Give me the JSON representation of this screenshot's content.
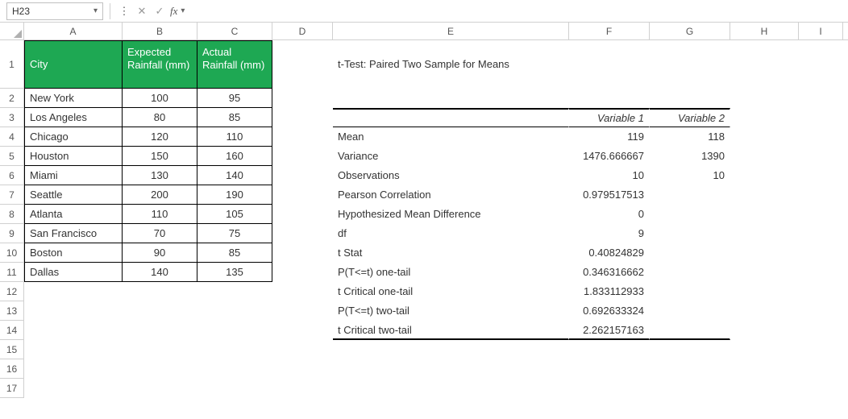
{
  "formula_bar": {
    "name_box": "H23",
    "formula_value": ""
  },
  "columns": [
    "A",
    "B",
    "C",
    "D",
    "E",
    "F",
    "G",
    "H",
    "I"
  ],
  "row_numbers": [
    1,
    2,
    3,
    4,
    5,
    6,
    7,
    8,
    9,
    10,
    11,
    12,
    13,
    14,
    15,
    16,
    17
  ],
  "data_table": {
    "headers": {
      "city": "City",
      "expected": "Expected Rainfall (mm)",
      "actual": "Actual Rainfall (mm)"
    },
    "rows": [
      {
        "city": "New York",
        "expected": 100,
        "actual": 95
      },
      {
        "city": "Los Angeles",
        "expected": 80,
        "actual": 85
      },
      {
        "city": "Chicago",
        "expected": 120,
        "actual": 110
      },
      {
        "city": "Houston",
        "expected": 150,
        "actual": 160
      },
      {
        "city": "Miami",
        "expected": 130,
        "actual": 140
      },
      {
        "city": "Seattle",
        "expected": 200,
        "actual": 190
      },
      {
        "city": "Atlanta",
        "expected": 110,
        "actual": 105
      },
      {
        "city": "San Francisco",
        "expected": 70,
        "actual": 75
      },
      {
        "city": "Boston",
        "expected": 90,
        "actual": 85
      },
      {
        "city": "Dallas",
        "expected": 140,
        "actual": 135
      }
    ]
  },
  "stats": {
    "title": "t-Test: Paired Two Sample for Means",
    "var1_label": "Variable 1",
    "var2_label": "Variable 2",
    "rows": [
      {
        "label": "Mean",
        "v1": "119",
        "v2": "118"
      },
      {
        "label": "Variance",
        "v1": "1476.666667",
        "v2": "1390"
      },
      {
        "label": "Observations",
        "v1": "10",
        "v2": "10"
      },
      {
        "label": "Pearson Correlation",
        "v1": "0.979517513",
        "v2": ""
      },
      {
        "label": "Hypothesized Mean Difference",
        "v1": "0",
        "v2": ""
      },
      {
        "label": "df",
        "v1": "9",
        "v2": ""
      },
      {
        "label": "t Stat",
        "v1": "0.40824829",
        "v2": ""
      },
      {
        "label": "P(T<=t) one-tail",
        "v1": "0.346316662",
        "v2": ""
      },
      {
        "label": "t Critical one-tail",
        "v1": "1.833112933",
        "v2": ""
      },
      {
        "label": "P(T<=t) two-tail",
        "v1": "0.692633324",
        "v2": ""
      },
      {
        "label": "t Critical two-tail",
        "v1": "2.262157163",
        "v2": ""
      }
    ]
  }
}
